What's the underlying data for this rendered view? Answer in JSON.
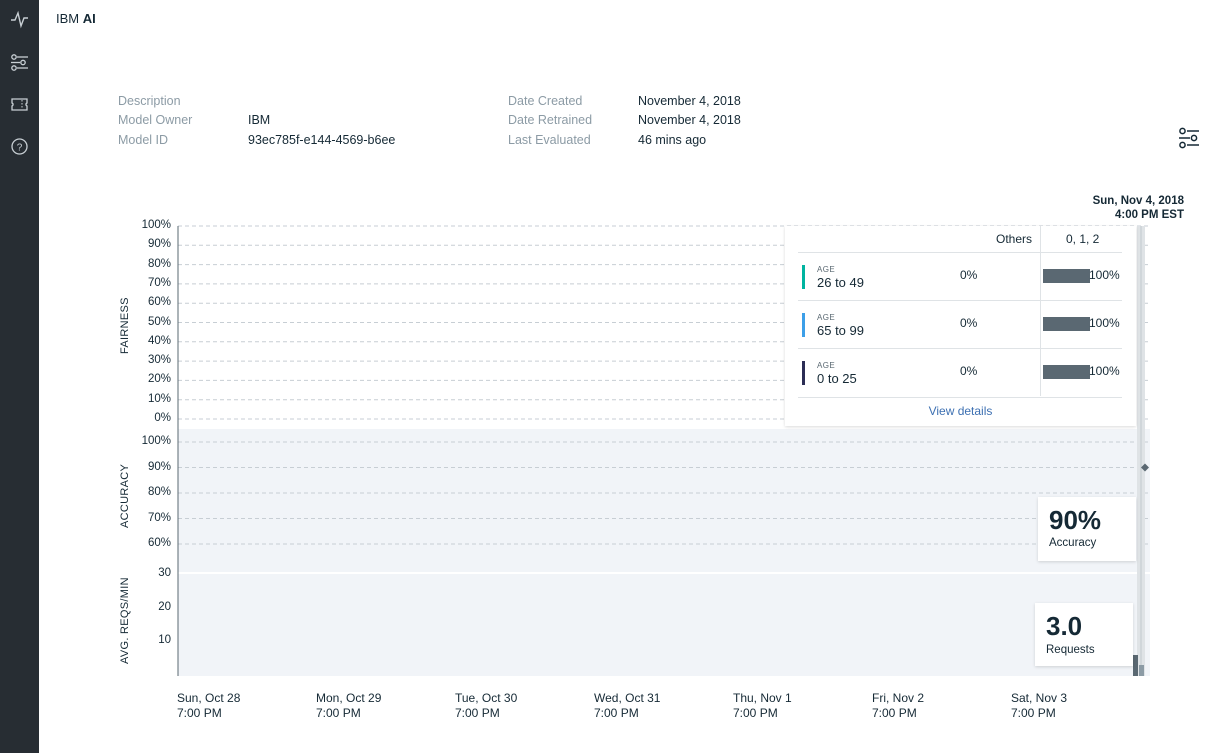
{
  "sidebar": {
    "icons": [
      "activity-icon",
      "sliders-icon",
      "ticket-icon",
      "help-icon"
    ]
  },
  "brand": {
    "prefix": "IBM",
    "bold": "AI"
  },
  "meta": {
    "left": [
      {
        "label": "Description",
        "value": ""
      },
      {
        "label": "Model Owner",
        "value": "IBM"
      },
      {
        "label": "Model ID",
        "value": "93ec785f-e144-4569-b6ee"
      }
    ],
    "right": [
      {
        "label": "Date Created",
        "value": "November 4, 2018"
      },
      {
        "label": "Date Retrained",
        "value": "November 4, 2018"
      },
      {
        "label": "Last Evaluated",
        "value": "46 mins ago"
      }
    ]
  },
  "timestamp": {
    "date": "Sun, Nov 4, 2018",
    "time": "4:00 PM EST"
  },
  "axes": {
    "fairness_title": "FAIRNESS",
    "accuracy_title": "ACCURACY",
    "requests_title": "AVG. REQS/MIN",
    "fairness_ticks": [
      "100%",
      "90%",
      "80%",
      "70%",
      "60%",
      "50%",
      "40%",
      "30%",
      "20%",
      "10%",
      "0%"
    ],
    "accuracy_ticks": [
      "100%",
      "90%",
      "80%",
      "70%",
      "60%"
    ],
    "requests_ticks": [
      "30",
      "20",
      "10"
    ]
  },
  "x_axis": [
    {
      "day": "Sun, Oct 28",
      "time": "7:00 PM"
    },
    {
      "day": "Mon, Oct 29",
      "time": "7:00 PM"
    },
    {
      "day": "Tue, Oct 30",
      "time": "7:00 PM"
    },
    {
      "day": "Wed, Oct 31",
      "time": "7:00 PM"
    },
    {
      "day": "Thu, Nov 1",
      "time": "7:00 PM"
    },
    {
      "day": "Fri, Nov 2",
      "time": "7:00 PM"
    },
    {
      "day": "Sat, Nov 3",
      "time": "7:00 PM"
    }
  ],
  "popup": {
    "header_others": "Others",
    "header_group": "0, 1, 2",
    "rows": [
      {
        "attr": "AGE",
        "range": "26 to 49",
        "others": "0%",
        "group": "100%",
        "color": "#00b4a0",
        "fill": 1.0
      },
      {
        "attr": "AGE",
        "range": "65 to 99",
        "others": "0%",
        "group": "100%",
        "color": "#3c9fe8",
        "fill": 1.0
      },
      {
        "attr": "AGE",
        "range": "0 to 25",
        "others": "0%",
        "group": "100%",
        "color": "#2b2d55",
        "fill": 1.0
      }
    ],
    "link": "View details"
  },
  "accuracy_card": {
    "value": "90%",
    "label": "Accuracy"
  },
  "requests_card": {
    "value": "3.0",
    "label": "Requests"
  },
  "chart_data": {
    "type": "line",
    "x": [
      "Sun, Oct 28 7:00 PM",
      "Mon, Oct 29 7:00 PM",
      "Tue, Oct 30 7:00 PM",
      "Wed, Oct 31 7:00 PM",
      "Thu, Nov 1 7:00 PM",
      "Fri, Nov 2 7:00 PM",
      "Sat, Nov 3 7:00 PM",
      "Sun, Nov 4, 2018 4:00 PM EST"
    ],
    "panels": [
      {
        "ylabel": "FAIRNESS",
        "ylim": [
          0,
          100
        ],
        "unit": "%",
        "grid": true
      },
      {
        "ylabel": "ACCURACY",
        "ylim": [
          60,
          100
        ],
        "unit": "%",
        "grid": true,
        "latest": 90
      },
      {
        "ylabel": "AVG. REQS/MIN",
        "ylim": [
          0,
          30
        ],
        "grid": false,
        "latest": 3.0
      }
    ]
  }
}
